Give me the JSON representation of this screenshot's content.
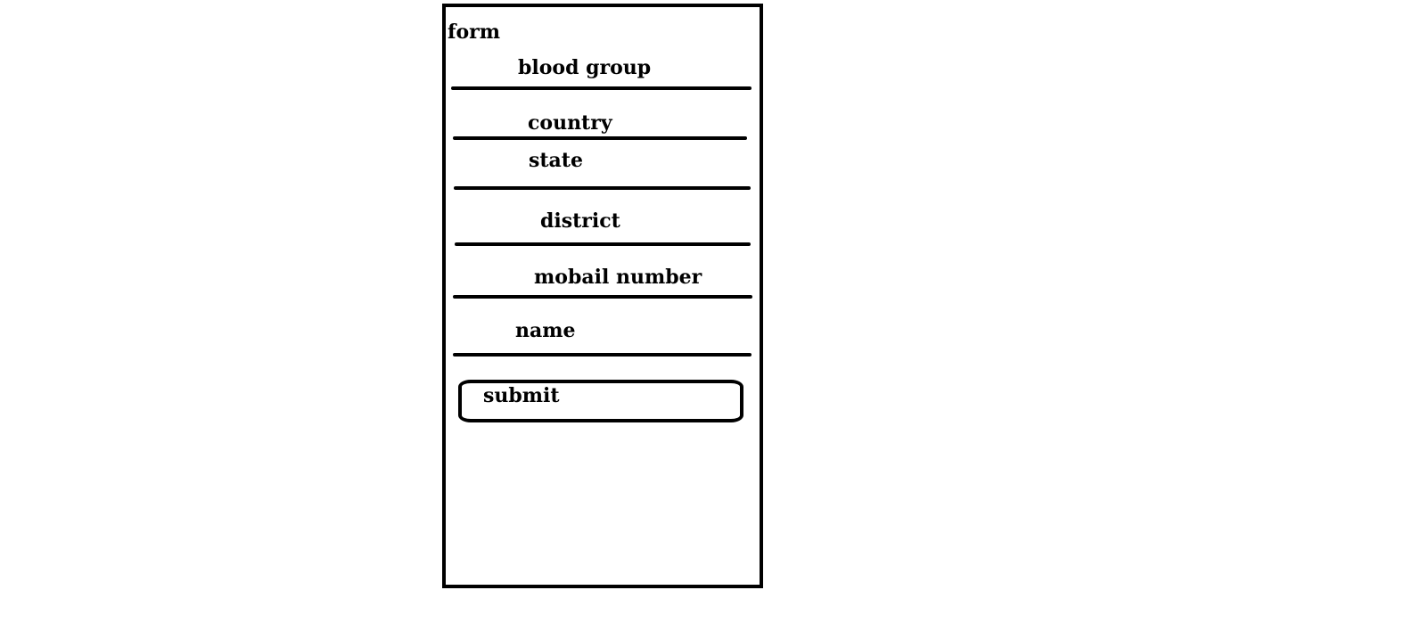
{
  "form": {
    "title": "form",
    "fields": [
      {
        "label": "blood group"
      },
      {
        "label": "country"
      },
      {
        "label": "state"
      },
      {
        "label": "district"
      },
      {
        "label": "mobail number"
      },
      {
        "label": "name"
      }
    ],
    "submit_label": "submit"
  }
}
